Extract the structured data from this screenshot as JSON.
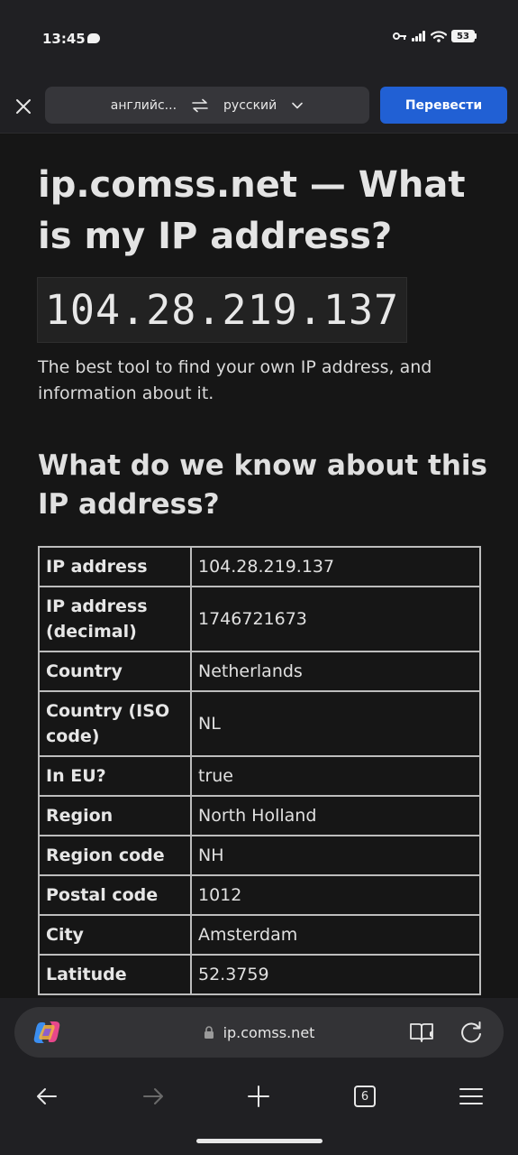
{
  "status_bar": {
    "time": "13:45",
    "battery": "53"
  },
  "translate_bar": {
    "source_lang": "английс...",
    "target_lang": "русский",
    "translate_label": "Перевести"
  },
  "page": {
    "title": "ip.comss.net — What is my IP address?",
    "ip_address": "104.28.219.137",
    "intro": "The best tool to find your own IP address, and information about it.",
    "section_title": "What do we know about this IP address?",
    "rows": [
      {
        "label": "IP address",
        "value": "104.28.219.137"
      },
      {
        "label": "IP address (decimal)",
        "value": "1746721673"
      },
      {
        "label": "Country",
        "value": "Netherlands"
      },
      {
        "label": "Country (ISO code)",
        "value": "NL"
      },
      {
        "label": "In EU?",
        "value": "true"
      },
      {
        "label": "Region",
        "value": "North Holland"
      },
      {
        "label": "Region code",
        "value": "NH"
      },
      {
        "label": "Postal code",
        "value": "1012"
      },
      {
        "label": "City",
        "value": "Amsterdam"
      },
      {
        "label": "Latitude",
        "value": "52.3759"
      }
    ]
  },
  "browser": {
    "url": "ip.comss.net",
    "tab_count": "6"
  },
  "icons": {
    "close": "close-icon",
    "swap": "swap-arrows-icon",
    "dropdown": "chevron-down-icon",
    "copilot": "copilot-icon",
    "lock": "lock-icon",
    "reader": "read-aloud-icon",
    "reload": "reload-icon",
    "back": "back-arrow-icon",
    "forward": "forward-arrow-icon",
    "new_tab": "plus-icon",
    "menu": "hamburger-menu-icon"
  },
  "colors": {
    "accent": "#2160d4",
    "background": "#161616",
    "chrome": "#202023"
  }
}
